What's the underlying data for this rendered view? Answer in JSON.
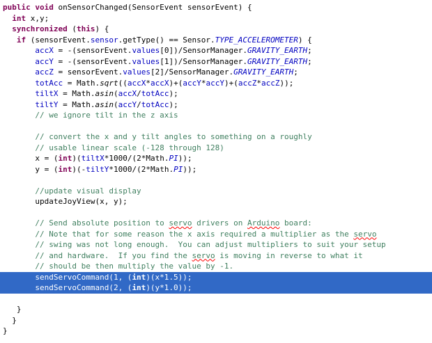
{
  "editor": {
    "lines": [
      {
        "selected": false,
        "tokens": [
          {
            "t": "public void",
            "k": "kw"
          },
          {
            "t": " onSensorChanged(SensorEvent sensorEvent) {",
            "k": ""
          }
        ]
      },
      {
        "selected": false,
        "tokens": [
          {
            "t": "  ",
            "k": ""
          },
          {
            "t": "int",
            "k": "kw"
          },
          {
            "t": " x,y;",
            "k": ""
          }
        ]
      },
      {
        "selected": false,
        "tokens": [
          {
            "t": "  ",
            "k": ""
          },
          {
            "t": "synchronized",
            "k": "kw"
          },
          {
            "t": " (",
            "k": ""
          },
          {
            "t": "this",
            "k": "kw"
          },
          {
            "t": ") {",
            "k": ""
          }
        ]
      },
      {
        "selected": false,
        "tokens": [
          {
            "t": "   ",
            "k": ""
          },
          {
            "t": "if",
            "k": "kw"
          },
          {
            "t": " (sensorEvent.",
            "k": ""
          },
          {
            "t": "sensor",
            "k": "fld"
          },
          {
            "t": ".getType() == Sensor.",
            "k": ""
          },
          {
            "t": "TYPE_ACCELEROMETER",
            "k": "cst"
          },
          {
            "t": ") {",
            "k": ""
          }
        ]
      },
      {
        "selected": false,
        "tokens": [
          {
            "t": "       ",
            "k": ""
          },
          {
            "t": "accX",
            "k": "fld"
          },
          {
            "t": " = -(sensorEvent.",
            "k": ""
          },
          {
            "t": "values",
            "k": "fld"
          },
          {
            "t": "[0])/SensorManager.",
            "k": ""
          },
          {
            "t": "GRAVITY_EARTH",
            "k": "cst"
          },
          {
            "t": ";",
            "k": ""
          }
        ]
      },
      {
        "selected": false,
        "tokens": [
          {
            "t": "       ",
            "k": ""
          },
          {
            "t": "accY",
            "k": "fld"
          },
          {
            "t": " = -(sensorEvent.",
            "k": ""
          },
          {
            "t": "values",
            "k": "fld"
          },
          {
            "t": "[1])/SensorManager.",
            "k": ""
          },
          {
            "t": "GRAVITY_EARTH",
            "k": "cst"
          },
          {
            "t": ";",
            "k": ""
          }
        ]
      },
      {
        "selected": false,
        "tokens": [
          {
            "t": "       ",
            "k": ""
          },
          {
            "t": "accZ",
            "k": "fld"
          },
          {
            "t": " = sensorEvent.",
            "k": ""
          },
          {
            "t": "values",
            "k": "fld"
          },
          {
            "t": "[2]/SensorManager.",
            "k": ""
          },
          {
            "t": "GRAVITY_EARTH",
            "k": "cst"
          },
          {
            "t": ";",
            "k": ""
          }
        ]
      },
      {
        "selected": false,
        "tokens": [
          {
            "t": "       ",
            "k": ""
          },
          {
            "t": "totAcc",
            "k": "fld"
          },
          {
            "t": " = Math.",
            "k": ""
          },
          {
            "t": "sqrt",
            "k": "stm"
          },
          {
            "t": "((",
            "k": ""
          },
          {
            "t": "accX",
            "k": "fld"
          },
          {
            "t": "*",
            "k": ""
          },
          {
            "t": "accX",
            "k": "fld"
          },
          {
            "t": ")+(",
            "k": ""
          },
          {
            "t": "accY",
            "k": "fld"
          },
          {
            "t": "*",
            "k": ""
          },
          {
            "t": "accY",
            "k": "fld"
          },
          {
            "t": ")+(",
            "k": ""
          },
          {
            "t": "accZ",
            "k": "fld"
          },
          {
            "t": "*",
            "k": ""
          },
          {
            "t": "accZ",
            "k": "fld"
          },
          {
            "t": "));",
            "k": ""
          }
        ]
      },
      {
        "selected": false,
        "tokens": [
          {
            "t": "       ",
            "k": ""
          },
          {
            "t": "tiltX",
            "k": "fld"
          },
          {
            "t": " = Math.",
            "k": ""
          },
          {
            "t": "asin",
            "k": "stm"
          },
          {
            "t": "(",
            "k": ""
          },
          {
            "t": "accX",
            "k": "fld"
          },
          {
            "t": "/",
            "k": ""
          },
          {
            "t": "totAcc",
            "k": "fld"
          },
          {
            "t": ");",
            "k": ""
          }
        ]
      },
      {
        "selected": false,
        "tokens": [
          {
            "t": "       ",
            "k": ""
          },
          {
            "t": "tiltY",
            "k": "fld"
          },
          {
            "t": " = Math.",
            "k": ""
          },
          {
            "t": "asin",
            "k": "stm"
          },
          {
            "t": "(",
            "k": ""
          },
          {
            "t": "accY",
            "k": "fld"
          },
          {
            "t": "/",
            "k": ""
          },
          {
            "t": "totAcc",
            "k": "fld"
          },
          {
            "t": ");",
            "k": ""
          }
        ]
      },
      {
        "selected": false,
        "tokens": [
          {
            "t": "       ",
            "k": ""
          },
          {
            "t": "// we ignore tilt in the z axis",
            "k": "cmt"
          }
        ]
      },
      {
        "selected": false,
        "tokens": []
      },
      {
        "selected": false,
        "tokens": [
          {
            "t": "       ",
            "k": ""
          },
          {
            "t": "// convert the x and y tilt angles to something on a roughly",
            "k": "cmt"
          }
        ]
      },
      {
        "selected": false,
        "tokens": [
          {
            "t": "       ",
            "k": ""
          },
          {
            "t": "// usable linear scale (-128 through 128)",
            "k": "cmt"
          }
        ]
      },
      {
        "selected": false,
        "tokens": [
          {
            "t": "       x = (",
            "k": ""
          },
          {
            "t": "int",
            "k": "kw"
          },
          {
            "t": ")(",
            "k": ""
          },
          {
            "t": "tiltX",
            "k": "fld"
          },
          {
            "t": "*1000/(2*Math.",
            "k": ""
          },
          {
            "t": "PI",
            "k": "cst"
          },
          {
            "t": "));",
            "k": ""
          }
        ]
      },
      {
        "selected": false,
        "tokens": [
          {
            "t": "       y = (",
            "k": ""
          },
          {
            "t": "int",
            "k": "kw"
          },
          {
            "t": ")(-",
            "k": ""
          },
          {
            "t": "tiltY",
            "k": "fld"
          },
          {
            "t": "*1000/(2*Math.",
            "k": ""
          },
          {
            "t": "PI",
            "k": "cst"
          },
          {
            "t": "));",
            "k": ""
          }
        ]
      },
      {
        "selected": false,
        "tokens": []
      },
      {
        "selected": false,
        "tokens": [
          {
            "t": "       ",
            "k": ""
          },
          {
            "t": "//update visual display",
            "k": "cmt"
          }
        ]
      },
      {
        "selected": false,
        "tokens": [
          {
            "t": "       updateJoyView(x, y);",
            "k": ""
          }
        ]
      },
      {
        "selected": false,
        "tokens": []
      },
      {
        "selected": false,
        "tokens": [
          {
            "t": "       ",
            "k": ""
          },
          {
            "t": "// Send absolute position to ",
            "k": "cmt"
          },
          {
            "t": "servo",
            "k": "cmt spell"
          },
          {
            "t": " drivers on ",
            "k": "cmt"
          },
          {
            "t": "Arduino",
            "k": "cmt spell"
          },
          {
            "t": " board:",
            "k": "cmt"
          }
        ]
      },
      {
        "selected": false,
        "tokens": [
          {
            "t": "       ",
            "k": ""
          },
          {
            "t": "// Note that for some reason the x axis required a multiplier as the ",
            "k": "cmt"
          },
          {
            "t": "servo",
            "k": "cmt spell"
          }
        ]
      },
      {
        "selected": false,
        "tokens": [
          {
            "t": "       ",
            "k": ""
          },
          {
            "t": "// swing was not long enough.  You can adjust multipliers to suit your setup",
            "k": "cmt"
          }
        ]
      },
      {
        "selected": false,
        "tokens": [
          {
            "t": "       ",
            "k": ""
          },
          {
            "t": "// and hardware.  If you find the ",
            "k": "cmt"
          },
          {
            "t": "servo",
            "k": "cmt spell"
          },
          {
            "t": " is moving in reverse to what it",
            "k": "cmt"
          }
        ]
      },
      {
        "selected": false,
        "tokens": [
          {
            "t": "       ",
            "k": ""
          },
          {
            "t": "// should be then multiply the value by -1.",
            "k": "cmt"
          }
        ]
      },
      {
        "selected": true,
        "tokens": [
          {
            "t": "       sendServoCommand(1, (",
            "k": ""
          },
          {
            "t": "int",
            "k": "kw"
          },
          {
            "t": ")(x*1.5));",
            "k": ""
          }
        ]
      },
      {
        "selected": true,
        "tokens": [
          {
            "t": "       sendServoCommand(2, (",
            "k": ""
          },
          {
            "t": "int",
            "k": "kw"
          },
          {
            "t": ")(y*1.0));",
            "k": ""
          }
        ]
      },
      {
        "selected": false,
        "tokens": []
      },
      {
        "selected": false,
        "tokens": [
          {
            "t": "   }",
            "k": ""
          }
        ]
      },
      {
        "selected": false,
        "tokens": [
          {
            "t": "  }",
            "k": ""
          }
        ]
      },
      {
        "selected": false,
        "tokens": [
          {
            "t": "}",
            "k": ""
          }
        ]
      }
    ]
  }
}
